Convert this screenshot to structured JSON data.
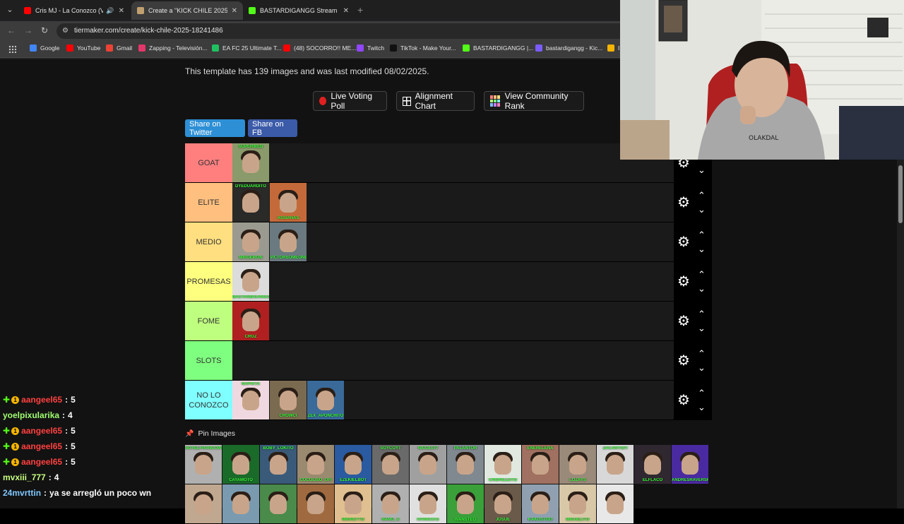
{
  "browser": {
    "tabs": [
      {
        "title": "Cris MJ - La Conozco (Visua",
        "color": "#ff0000",
        "active": false,
        "audio": true
      },
      {
        "title": "Create a \"KICK CHILE 2025\" Tier",
        "color": "#c0a070",
        "active": true,
        "audio": false
      },
      {
        "title": "BASTARDIGANGG Stream - Wa",
        "color": "#53fc18",
        "active": false,
        "audio": false
      }
    ],
    "url": "tiermaker.com/create/kick-chile-2025-18241486",
    "bookmarks": [
      {
        "label": "Google",
        "color": "#4285f4"
      },
      {
        "label": "YouTube",
        "color": "#ff0000"
      },
      {
        "label": "Gmail",
        "color": "#ea4335"
      },
      {
        "label": "Zapping - Televisión...",
        "color": "#e3366a"
      },
      {
        "label": "EA FC 25 Ultimate T...",
        "color": "#20c060"
      },
      {
        "label": "(48) SOCORRO!! ME...",
        "color": "#ff0000"
      },
      {
        "label": "Twitch",
        "color": "#9146ff"
      },
      {
        "label": "TikTok - Make Your...",
        "color": "#111111"
      },
      {
        "label": "BASTARDIGANGG |...",
        "color": "#53fc18"
      },
      {
        "label": "bastardigangg - Kic...",
        "color": "#7a5cff"
      },
      {
        "label": "I",
        "color": "#f4b400"
      }
    ]
  },
  "page": {
    "info": "This template has 139 images and was last modified 08/02/2025.",
    "buttons": {
      "live_voting": "Live Voting Poll",
      "alignment": "Alignment Chart",
      "community": "View Community Rank",
      "share_twitter": "Share on Twitter",
      "share_fb": "Share on FB"
    },
    "pin_label": "Pin Images",
    "tiers": [
      {
        "label": "GOAT",
        "color": "#ff7f7f",
        "items": [
          {
            "bg": "#8a9a6a",
            "tagtop": "SUPERWEB"
          }
        ]
      },
      {
        "label": "ELITE",
        "color": "#ffbf7f",
        "items": [
          {
            "bg": "#2a2a28",
            "tagtop": "DYEDUARDITO"
          },
          {
            "bg": "#c46a3a",
            "tag": "ASSIANAS"
          }
        ]
      },
      {
        "label": "MEDIO",
        "color": "#ffdf7f",
        "items": [
          {
            "bg": "#9a9a90",
            "tag": "MIRDEMON"
          },
          {
            "bg": "#6a7a80",
            "tag": "VICTORSOMEONE"
          }
        ]
      },
      {
        "label": "PROMESAS",
        "color": "#ffff7f",
        "items": [
          {
            "bg": "#dcdcdc",
            "tag": "BASTARDIGANGG"
          }
        ]
      },
      {
        "label": "FOME",
        "color": "#bfff7f",
        "items": [
          {
            "bg": "#b02020",
            "tag": "CROZ"
          }
        ]
      },
      {
        "label": "SLOTS",
        "color": "#7fff7f",
        "items": []
      },
      {
        "label": "NO LO CONOZCO",
        "color": "#7fffff",
        "items": [
          {
            "bg": "#f0d8e0",
            "tagtop": "NAPIXTA"
          },
          {
            "bg": "#7a6a50",
            "tag": "CROWCI"
          },
          {
            "bg": "#3a6a9a",
            "tag": "ZEX_APONCHITO"
          }
        ]
      }
    ],
    "pool": [
      {
        "bg": "#b0b0b0",
        "tagtop": "SOYELFRANCOW"
      },
      {
        "bg": "#1a6a2a",
        "tag": "CAYAMOTO"
      },
      {
        "bg": "#3a5a7a",
        "tagtop": "BOBY_LOKITO"
      },
      {
        "bg": "#9a8a70",
        "tag": "COCOLISO_OFI"
      },
      {
        "bg": "#2a5aa0",
        "tag": "EZEKIELBOT"
      },
      {
        "bg": "#6a6a6a",
        "tagtop": "SOYCOYT"
      },
      {
        "bg": "#a0a0a0",
        "tagtop": "NICOL077"
      },
      {
        "bg": "#808890",
        "tagtop": "PALANTOR"
      },
      {
        "bg": "#e0e8e0",
        "tag": "CRIDREZZITO"
      },
      {
        "bg": "#a07060",
        "tagtop": "ENERELENA"
      },
      {
        "bg": "#9a8a7a",
        "tag": "LOZAYS"
      },
      {
        "bg": "#d8d8d8",
        "tagtop": "ZACARYOFI"
      },
      {
        "bg": "#302830",
        "tag": "ELFLACO"
      },
      {
        "bg": "#4a2aa0",
        "tag": "ANDRESRAVERSHOW"
      },
      {
        "bg": "#c0a890",
        "tag": ""
      },
      {
        "bg": "#7a9ab0",
        "tag": ""
      },
      {
        "bg": "#4a8a4a",
        "tag": ""
      },
      {
        "bg": "#a06a40",
        "tag": ""
      },
      {
        "bg": "#e0c090",
        "tag": "MIGRETTO"
      },
      {
        "bg": "#b0b0b0",
        "tag": "NANO_A"
      },
      {
        "bg": "#e0e0e0",
        "tag": "IVANOCKS"
      },
      {
        "bg": "#3aa03a",
        "tag": "IVANSTEO"
      },
      {
        "bg": "#6a5a4a",
        "tag": "JOSUE"
      },
      {
        "bg": "#90a0b0",
        "tag": "KAKOSTGO"
      },
      {
        "bg": "#d8c8a8",
        "tag": "MIGUELITO"
      },
      {
        "bg": "#e8e8e8",
        "tag": ""
      }
    ]
  },
  "chat": [
    {
      "user": "aangeel65",
      "text": "5",
      "badges": true,
      "color": "#ff4040"
    },
    {
      "user": "yoelpixularika",
      "text": "4",
      "badges": false,
      "color": "#a0ff70"
    },
    {
      "user": "aangeel65",
      "text": "5",
      "badges": true,
      "color": "#ff4040"
    },
    {
      "user": "aangeel65",
      "text": "5",
      "badges": true,
      "color": "#ff4040"
    },
    {
      "user": "aangeel65",
      "text": "5",
      "badges": true,
      "color": "#ff4040"
    },
    {
      "user": "mvxiii_777",
      "text": "4",
      "badges": false,
      "color": "#c8ff80"
    },
    {
      "user": "24mvrttin",
      "text": "ya se arregló un poco wn",
      "badges": false,
      "color": "#80c8ff"
    }
  ]
}
